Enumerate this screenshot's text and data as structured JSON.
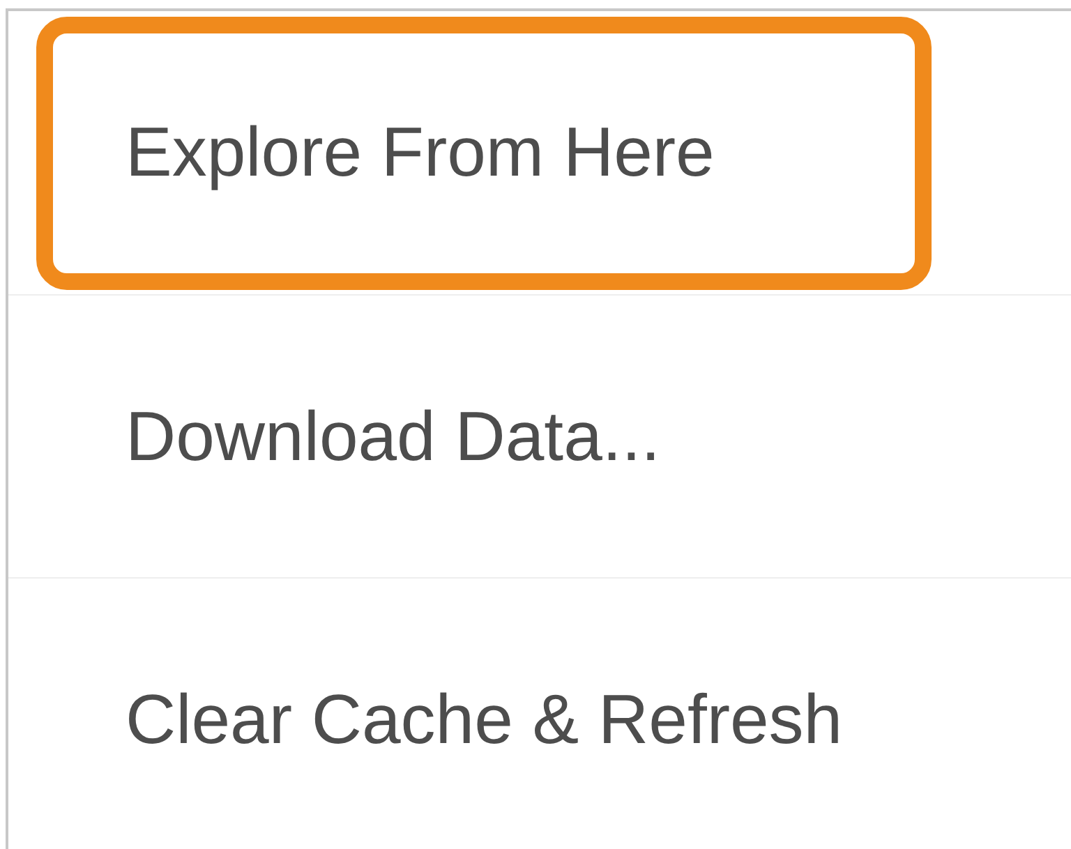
{
  "menu": {
    "items": [
      {
        "label": "Explore From Here",
        "highlighted": true
      },
      {
        "label": "Download Data...",
        "highlighted": false
      },
      {
        "label": "Clear Cache & Refresh",
        "highlighted": false
      }
    ]
  }
}
